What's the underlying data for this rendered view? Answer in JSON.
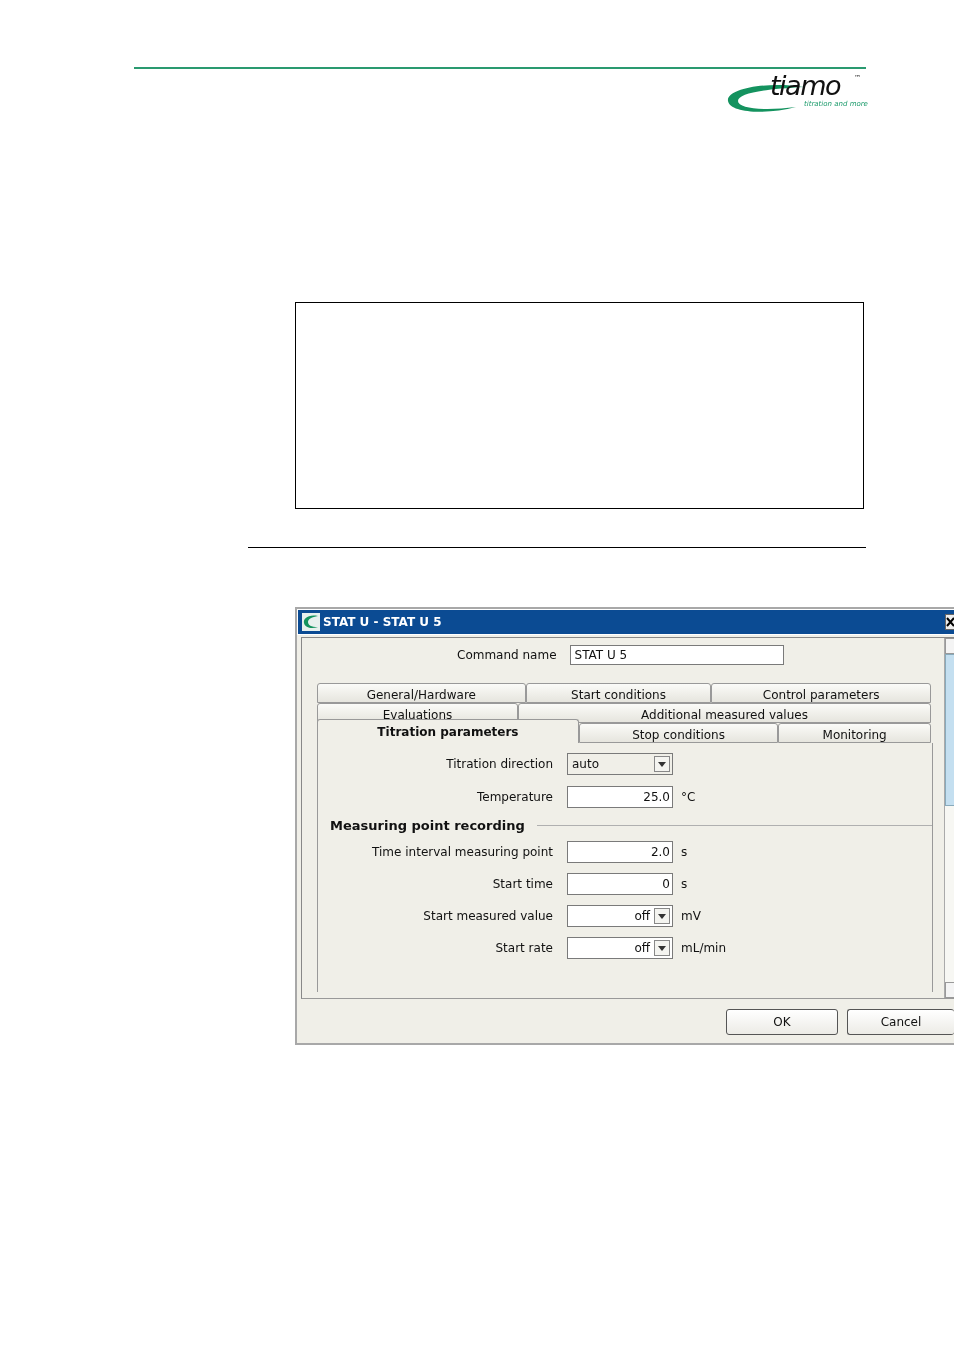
{
  "logo": {
    "wordmark": "tiamo",
    "trademark": "™",
    "tagline": "titration and more"
  },
  "dialog": {
    "title": "STAT U - STAT U 5",
    "command_name": {
      "label": "Command name",
      "value": "STAT U 5"
    },
    "tab_rows": [
      [
        {
          "label": "General/Hardware",
          "selected": false
        },
        {
          "label": "Start conditions",
          "selected": false
        },
        {
          "label": "Control parameters",
          "selected": false
        }
      ],
      [
        {
          "label": "Evaluations",
          "selected": false
        },
        {
          "label": "Additional measured values",
          "selected": false
        }
      ],
      [
        {
          "label": "Titration parameters",
          "selected": true
        },
        {
          "label": "Stop conditions",
          "selected": false
        },
        {
          "label": "Monitoring",
          "selected": false
        }
      ]
    ],
    "fields": [
      {
        "kind": "combo",
        "label": "Titration direction",
        "value": "auto"
      },
      {
        "kind": "number",
        "label": "Temperature",
        "value": "25.0",
        "unit": "°C"
      }
    ],
    "section": {
      "title": "Measuring point recording",
      "fields": [
        {
          "kind": "number",
          "label": "Time interval measuring point",
          "value": "2.0",
          "unit": "s"
        },
        {
          "kind": "number",
          "label": "Start time",
          "value": "0",
          "unit": "s"
        },
        {
          "kind": "dropdown",
          "label": "Start measured value",
          "value": "off",
          "unit": "mV"
        },
        {
          "kind": "dropdown",
          "label": "Start rate",
          "value": "off",
          "unit": "mL/min"
        }
      ]
    },
    "buttons": [
      "OK",
      "Cancel"
    ]
  }
}
